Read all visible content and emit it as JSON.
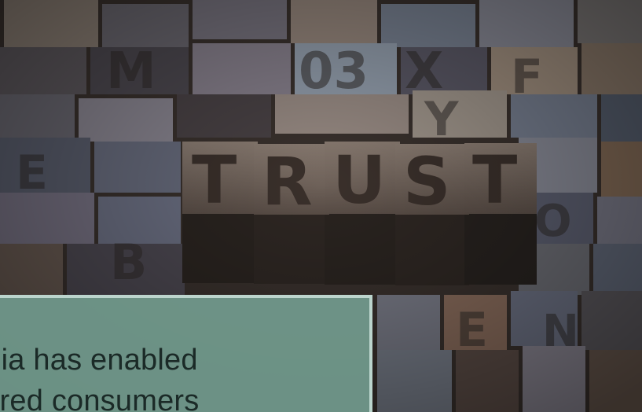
{
  "photo": {
    "subject": "TRUST",
    "icon": "letterpress-type-photo"
  },
  "caption": {
    "line1": "edia has enabled",
    "line2": "vered consumers"
  },
  "colors": {
    "caption_bg": "#78a496",
    "caption_border": "#c4ddd5",
    "caption_text": "#1b2a27",
    "block_face": "#6f6258",
    "block_dark": "#2a2420"
  }
}
